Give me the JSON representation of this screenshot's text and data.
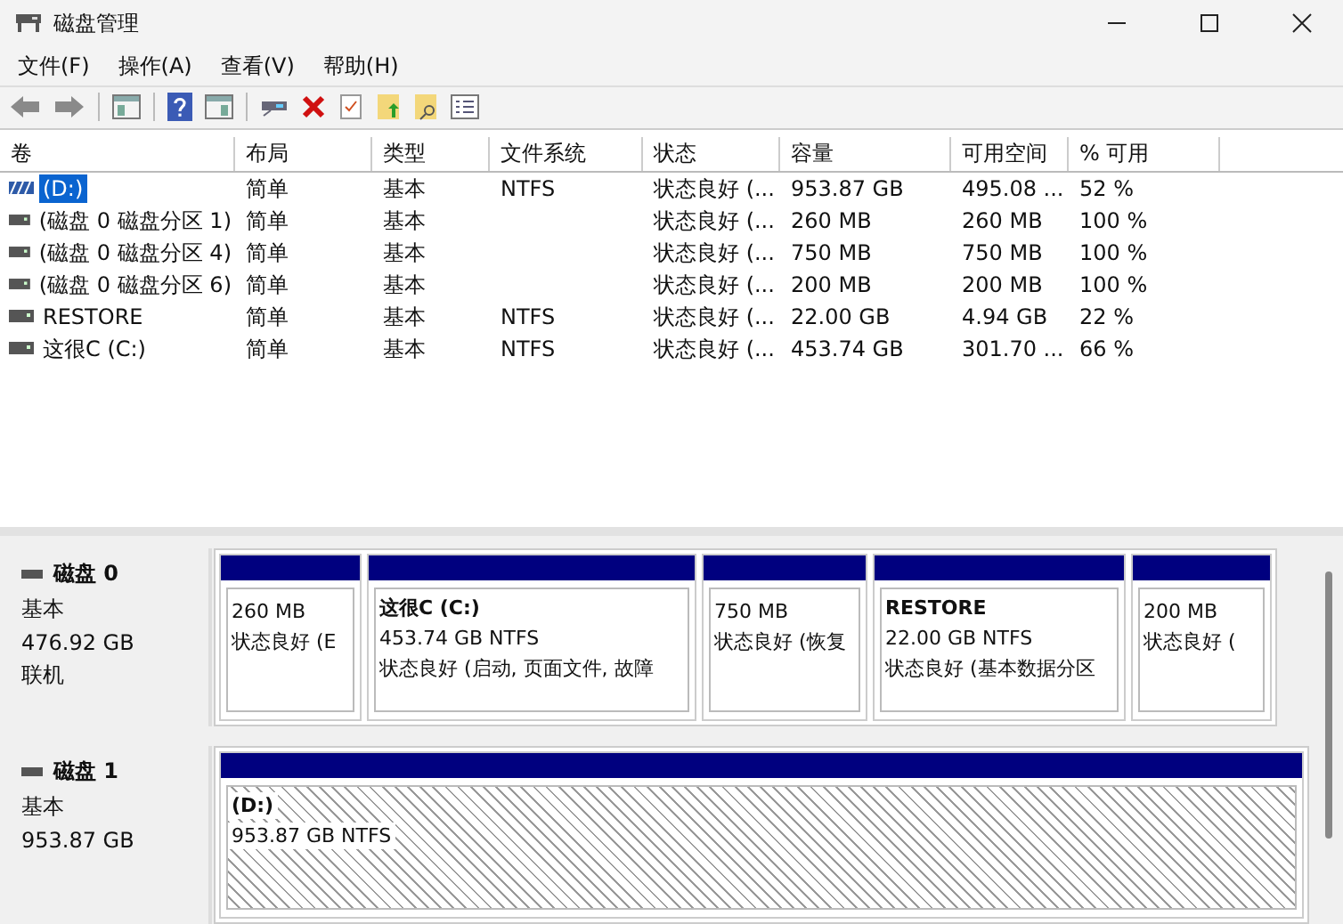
{
  "window": {
    "title": "磁盘管理"
  },
  "menu": [
    "文件(F)",
    "操作(A)",
    "查看(V)",
    "帮助(H)"
  ],
  "table": {
    "columns": [
      "卷",
      "布局",
      "类型",
      "文件系统",
      "状态",
      "容量",
      "可用空间",
      "% 可用"
    ],
    "rows": [
      {
        "kind": "striped",
        "selected": true,
        "cells": [
          "(D:)",
          "简单",
          "基本",
          "NTFS",
          "状态良好 (...",
          "953.87 GB",
          "495.08 ...",
          "52 %"
        ]
      },
      {
        "kind": "plain",
        "selected": false,
        "cells": [
          "(磁盘 0 磁盘分区 1)",
          "简单",
          "基本",
          "",
          "状态良好 (...",
          "260 MB",
          "260 MB",
          "100 %"
        ]
      },
      {
        "kind": "plain",
        "selected": false,
        "cells": [
          "(磁盘 0 磁盘分区 4)",
          "简单",
          "基本",
          "",
          "状态良好 (...",
          "750 MB",
          "750 MB",
          "100 %"
        ]
      },
      {
        "kind": "plain",
        "selected": false,
        "cells": [
          "(磁盘 0 磁盘分区 6)",
          "简单",
          "基本",
          "",
          "状态良好 (...",
          "200 MB",
          "200 MB",
          "100 %"
        ]
      },
      {
        "kind": "plain",
        "selected": false,
        "cells": [
          "RESTORE",
          "简单",
          "基本",
          "NTFS",
          "状态良好 (...",
          "22.00 GB",
          "4.94 GB",
          "22 %"
        ]
      },
      {
        "kind": "plain",
        "selected": false,
        "cells": [
          "这很C (C:)",
          "简单",
          "基本",
          "NTFS",
          "状态良好 (...",
          "453.74 GB",
          "301.70 ...",
          "66 %"
        ]
      }
    ]
  },
  "disks": [
    {
      "name": "磁盘 0",
      "type": "基本",
      "size": "476.92 GB",
      "status": "联机",
      "partitions": [
        {
          "size": "260 MB",
          "status": "状态良好 (E",
          "selected": false
        },
        {
          "name": "这很C  (C:)",
          "size": "453.74 GB NTFS",
          "status": "状态良好 (启动, 页面文件, 故障",
          "selected": false
        },
        {
          "size": "750 MB",
          "status": "状态良好 (恢复",
          "selected": false
        },
        {
          "name": "RESTORE",
          "size": "22.00 GB NTFS",
          "status": "状态良好 (基本数据分区",
          "selected": false
        },
        {
          "size": "200 MB",
          "status": "状态良好 (",
          "selected": false
        }
      ]
    },
    {
      "name": "磁盘 1",
      "type": "基本",
      "size": "953.87 GB",
      "partitions": [
        {
          "name": "(D:)",
          "size": "953.87 GB NTFS",
          "selected": true
        }
      ]
    }
  ]
}
